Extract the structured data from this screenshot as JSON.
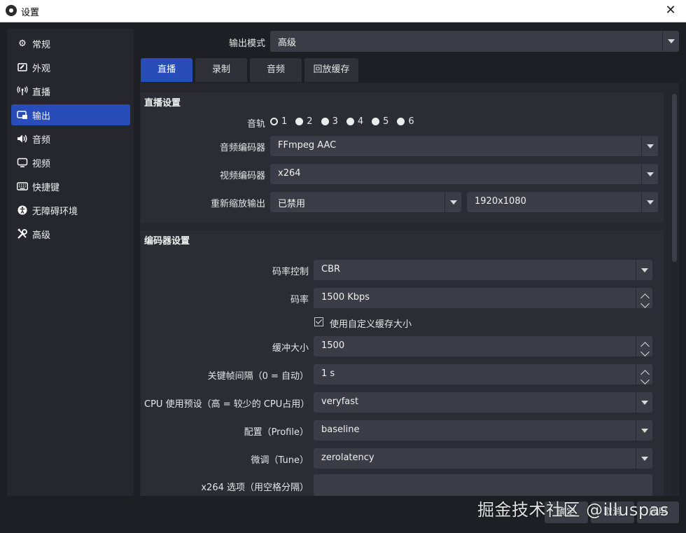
{
  "window": {
    "title": "设置"
  },
  "sidebar": {
    "items": [
      {
        "label": "常规",
        "icon": "gear-icon"
      },
      {
        "label": "外观",
        "icon": "appearance-icon"
      },
      {
        "label": "直播",
        "icon": "broadcast-icon"
      },
      {
        "label": "输出",
        "icon": "output-icon"
      },
      {
        "label": "音频",
        "icon": "speaker-icon"
      },
      {
        "label": "视频",
        "icon": "monitor-icon"
      },
      {
        "label": "快捷键",
        "icon": "keyboard-icon"
      },
      {
        "label": "无障碍环境",
        "icon": "accessibility-icon"
      },
      {
        "label": "高级",
        "icon": "tools-icon"
      }
    ],
    "active": "输出"
  },
  "output_mode": {
    "label": "输出模式",
    "value": "高级"
  },
  "tabs": [
    "直播",
    "录制",
    "音频",
    "回放缓存"
  ],
  "active_tab": "直播",
  "stream_settings": {
    "title": "直播设置",
    "audio_track_label": "音轨",
    "tracks": [
      "1",
      "2",
      "3",
      "4",
      "5",
      "6"
    ],
    "selected_track": "1",
    "audio_encoder_label": "音频编码器",
    "audio_encoder": "FFmpeg AAC",
    "video_encoder_label": "视频编码器",
    "video_encoder": "x264",
    "rescale_label": "重新缩放输出",
    "rescale_value": "已禁用",
    "rescale_resolution": "1920x1080"
  },
  "encoder_settings": {
    "title": "编码器设置",
    "rate_control_label": "码率控制",
    "rate_control": "CBR",
    "bitrate_label": "码率",
    "bitrate": "1500 Kbps",
    "custom_buffer_label": "使用自定义缓存大小",
    "custom_buffer_checked": true,
    "buffer_size_label": "缓冲大小",
    "buffer_size": "1500",
    "keyframe_label": "关键帧间隔（0 = 自动）",
    "keyframe": "1 s",
    "cpu_preset_label": "CPU 使用预设（高 = 较少的 CPU占用）",
    "cpu_preset": "veryfast",
    "profile_label": "配置（Profile）",
    "profile": "baseline",
    "tune_label": "微调（Tune）",
    "tune": "zerolatency",
    "x264_options_label": "x264 选项（用空格分隔）",
    "x264_options": ""
  },
  "footer": {
    "ok": "确定",
    "cancel": "取消",
    "apply": "应用"
  },
  "watermark": "掘金技术社区 @illuspas",
  "colors": {
    "accent": "#284cb8",
    "background": "#1e1f24",
    "field": "#3b3c45"
  }
}
